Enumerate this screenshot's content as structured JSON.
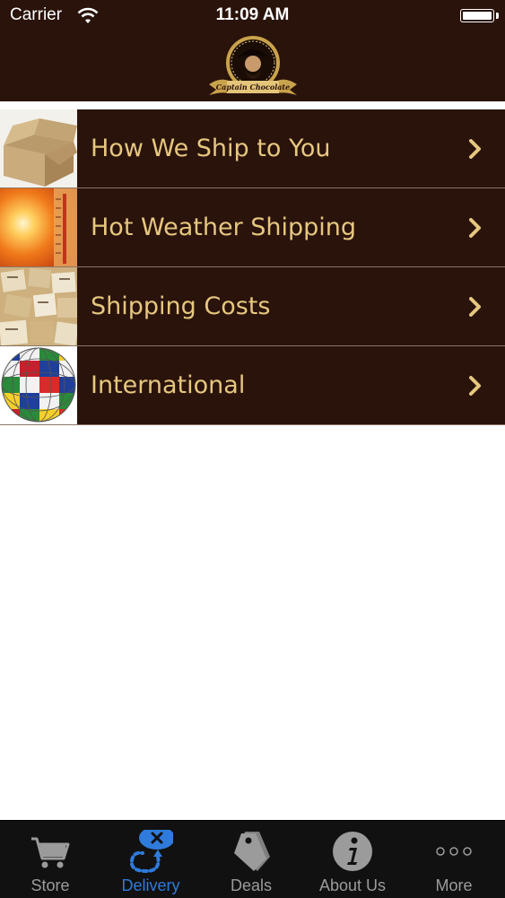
{
  "status_bar": {
    "carrier": "Carrier",
    "time": "11:09 AM"
  },
  "header": {
    "logo_icon": "captain-chocolate-logo",
    "logo_text": "Captain Chocolate"
  },
  "menu": {
    "items": [
      {
        "label": "How We Ship to You",
        "icon": "cardboard-box-image"
      },
      {
        "label": "Hot Weather Shipping",
        "icon": "sun-thermometer-image"
      },
      {
        "label": "Shipping Costs",
        "icon": "packages-image"
      },
      {
        "label": "International",
        "icon": "flag-globe-image"
      }
    ]
  },
  "tabbar": {
    "tabs": [
      {
        "label": "Store",
        "icon": "cart-icon",
        "active": false
      },
      {
        "label": "Delivery",
        "icon": "delivery-route-icon",
        "active": true
      },
      {
        "label": "Deals",
        "icon": "tags-icon",
        "active": false
      },
      {
        "label": "About Us",
        "icon": "info-icon",
        "active": false
      },
      {
        "label": "More",
        "icon": "more-icon",
        "active": false
      }
    ]
  },
  "colors": {
    "header_bg": "#2a130b",
    "row_bg": "#2a130b",
    "row_text": "#e6c77f",
    "tab_active": "#2f7bdc",
    "tab_inactive": "#9b9b9b"
  }
}
